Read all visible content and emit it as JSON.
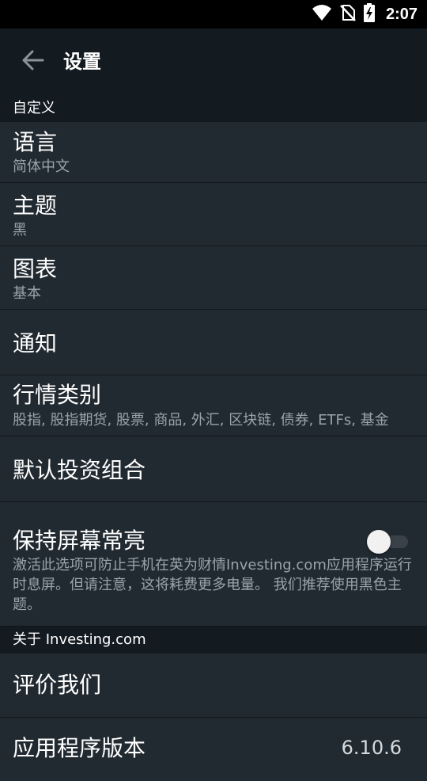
{
  "status_bar": {
    "time": "2:07",
    "icons": [
      "wifi-icon",
      "no-sim-icon",
      "battery-charging-icon"
    ]
  },
  "app_bar": {
    "back_icon": "arrow-left-icon",
    "title": "设置"
  },
  "sections": {
    "customize": "自定义",
    "about": "关于 Investing.com"
  },
  "settings": {
    "language": {
      "title": "语言",
      "value": "简体中文"
    },
    "theme": {
      "title": "主题",
      "value": "黑"
    },
    "charts": {
      "title": "图表",
      "value": "基本"
    },
    "notifications": {
      "title": "通知"
    },
    "market_categories": {
      "title": "行情类别",
      "value": "股指, 股指期货, 股票, 商品, 外汇, 区块链, 债券, ETFs, 基金"
    },
    "default_portfolio": {
      "title": "默认投资组合"
    },
    "keep_screen_on": {
      "title": "保持屏幕常亮",
      "description": "激活此选项可防止手机在英为财情Investing.com应用程序运行时息屏。但请注意，这将耗费更多电量。 我们推荐使用黑色主题。",
      "enabled": false
    },
    "rate_us": {
      "title": "评价我们"
    },
    "app_version": {
      "title": "应用程序版本",
      "value": "6.10.6"
    }
  },
  "colors": {
    "background": "#1d232a",
    "row_background": "#222a31",
    "header_background": "#131a20",
    "secondary_text": "#9aa3ab"
  }
}
